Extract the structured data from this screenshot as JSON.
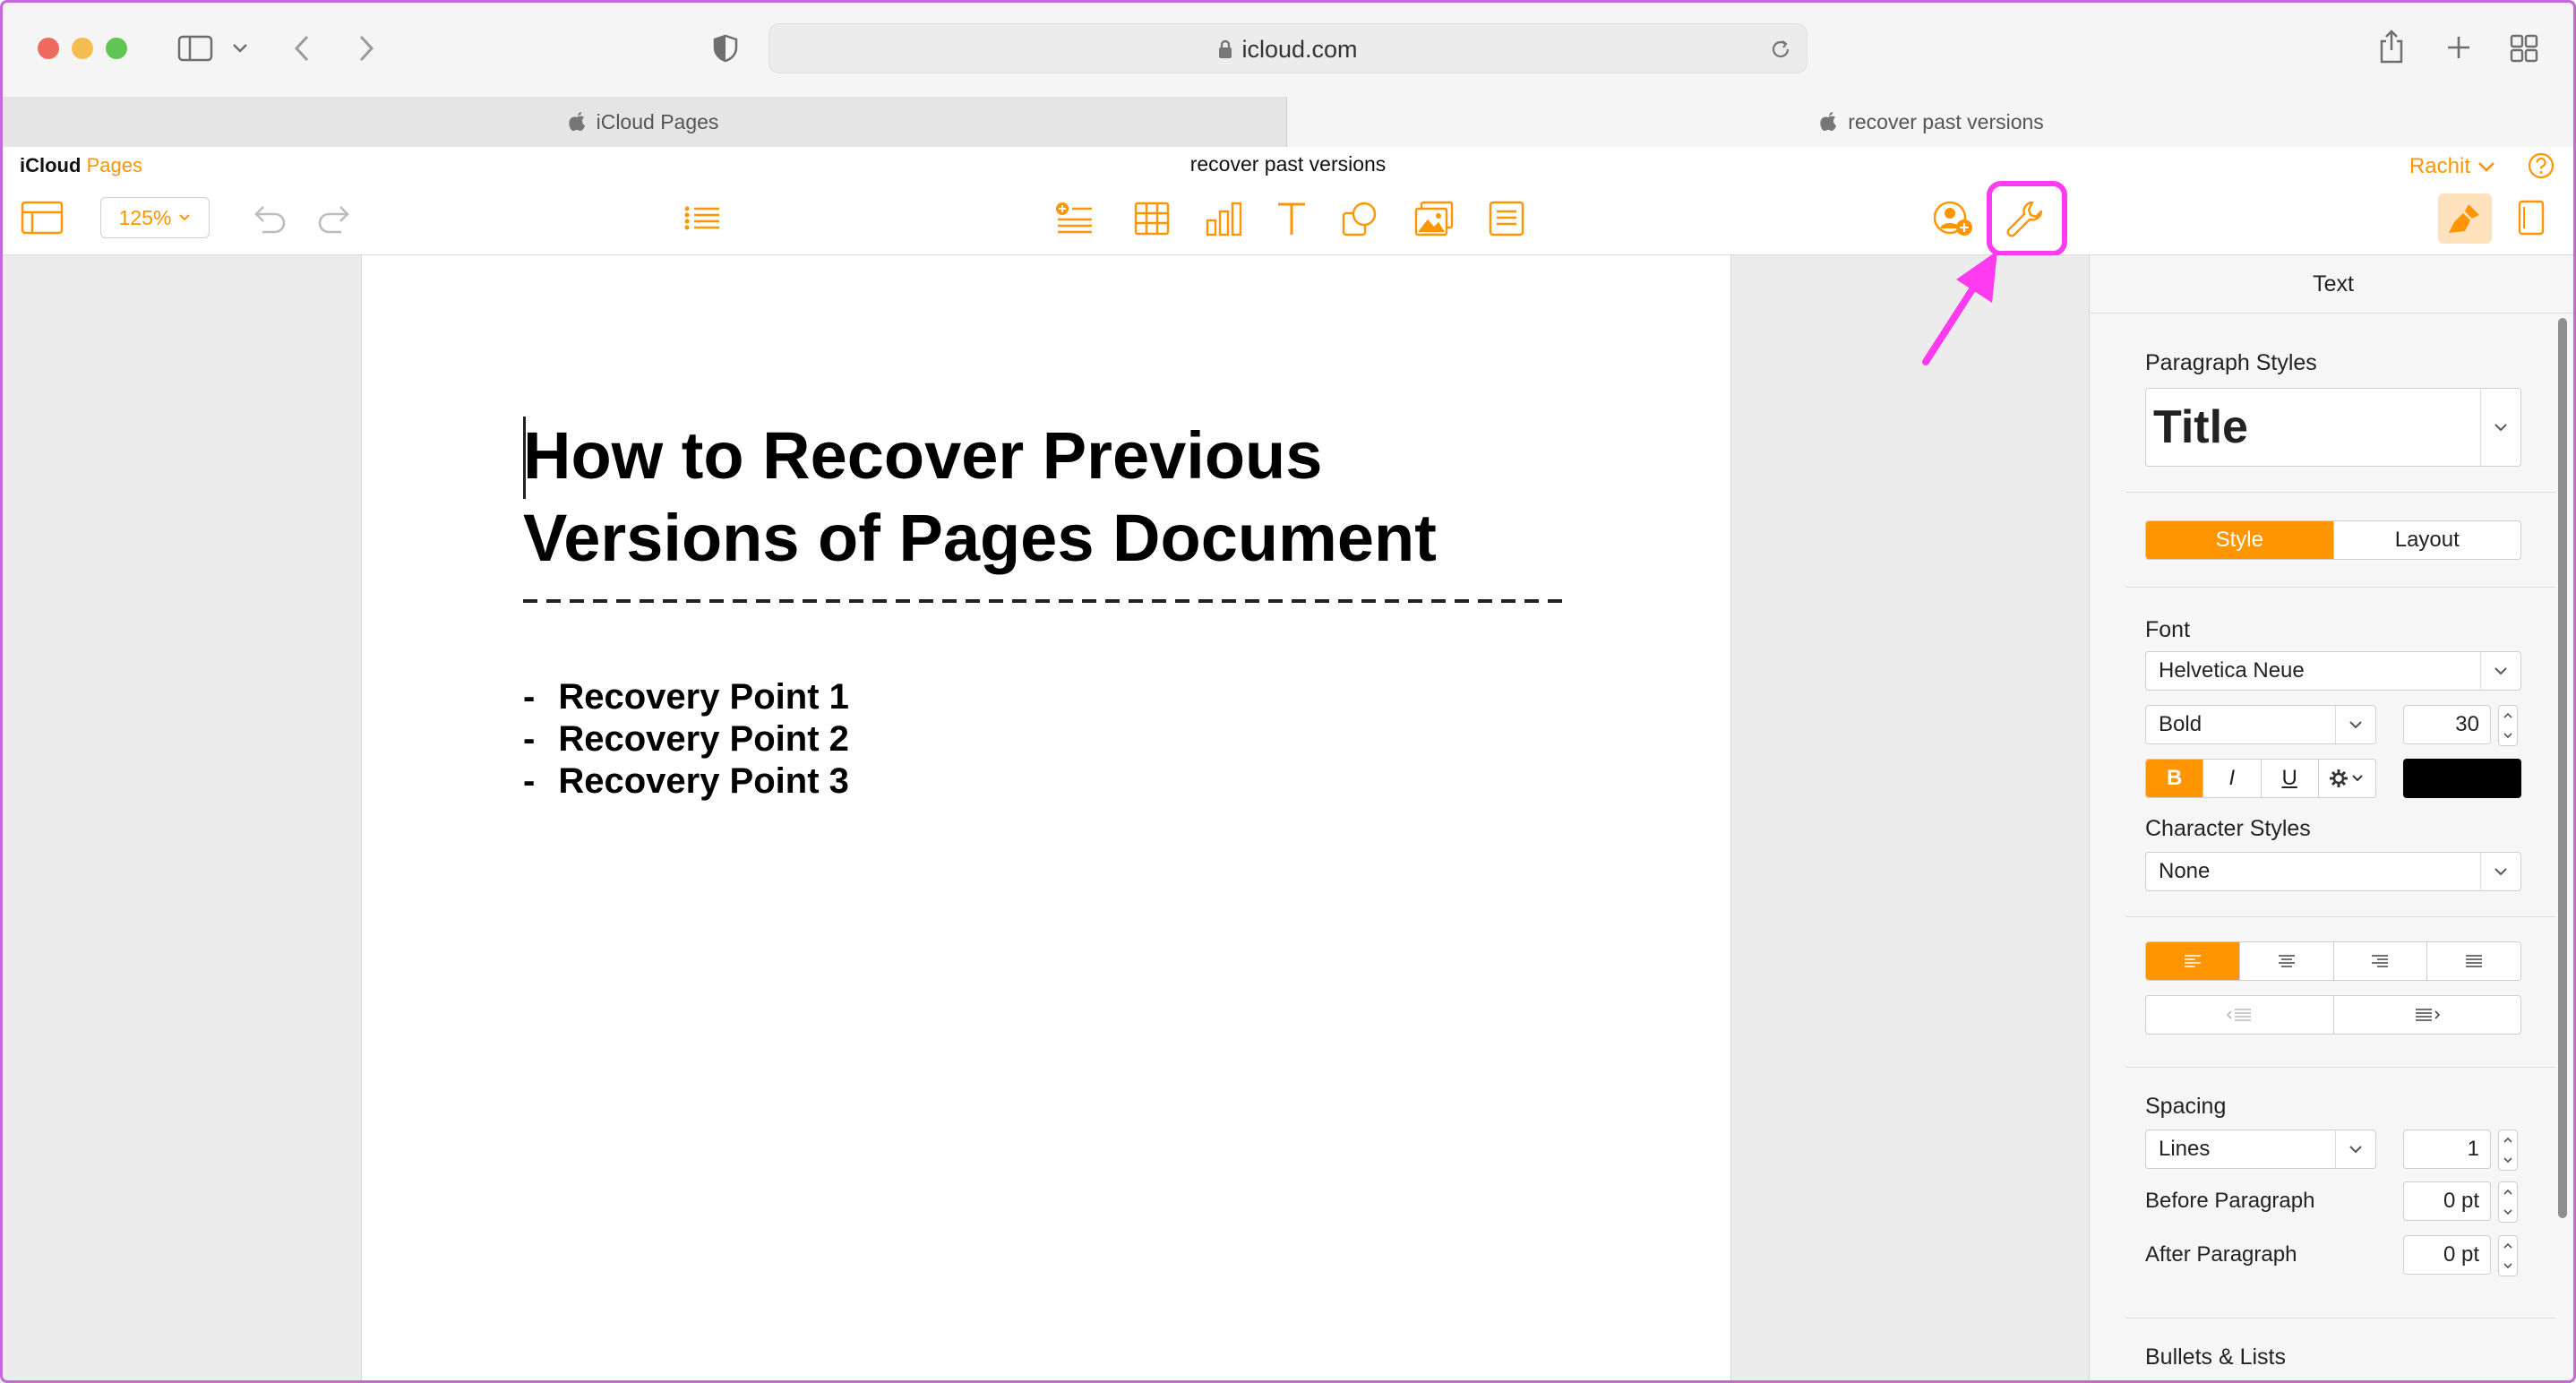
{
  "browser": {
    "url": "icloud.com",
    "tabs": [
      {
        "label": "iCloud Pages",
        "active": false
      },
      {
        "label": "recover past versions",
        "active": true
      }
    ]
  },
  "app": {
    "brand_primary": "iCloud",
    "brand_secondary": "Pages",
    "document_title": "recover past versions",
    "user_name": "Rachit",
    "zoom": "125%",
    "accent_color": "#ff9500",
    "highlight_color": "#ff3bf0"
  },
  "toolbar": {
    "left_icons": [
      "sidebar-view-icon",
      "undo-icon",
      "redo-icon",
      "list-icon"
    ],
    "insert_icons": [
      "add-row-icon",
      "table-icon",
      "chart-icon",
      "text-icon",
      "shape-icon",
      "media-icon",
      "comment-icon"
    ],
    "right_icons": [
      "collaborate-icon",
      "wrench-icon",
      "format-brush-icon",
      "document-icon"
    ]
  },
  "document": {
    "title_lines": [
      "How to Recover Previous",
      "Versions of Pages Document"
    ],
    "bullets": [
      {
        "marker": "-",
        "text": "Recovery Point 1"
      },
      {
        "marker": "-",
        "text": "Recovery Point 2"
      },
      {
        "marker": "-",
        "text": "Recovery Point 3"
      }
    ]
  },
  "inspector": {
    "header": "Text",
    "paragraph_styles_label": "Paragraph Styles",
    "paragraph_style": "Title",
    "tabs": [
      "Style",
      "Layout"
    ],
    "font_label": "Font",
    "font_family": "Helvetica Neue",
    "font_weight": "Bold",
    "font_size": "30",
    "format_buttons": {
      "bold": "B",
      "italic": "I",
      "underline": "U"
    },
    "text_color": "#000000",
    "character_styles_label": "Character Styles",
    "character_style": "None",
    "spacing_label": "Spacing",
    "spacing_mode": "Lines",
    "spacing_value": "1",
    "before_paragraph_label": "Before Paragraph",
    "before_paragraph_value": "0 pt",
    "after_paragraph_label": "After Paragraph",
    "after_paragraph_value": "0 pt",
    "bullets_lists_label": "Bullets & Lists"
  }
}
